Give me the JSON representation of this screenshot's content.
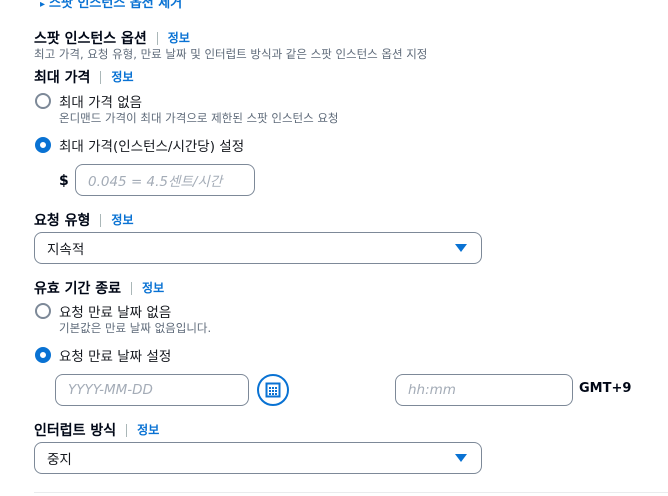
{
  "top_link": {
    "label": "스팟 인스턴스 옵션 제거"
  },
  "spot_options": {
    "title": "스팟 인스턴스 옵션",
    "info": "정보",
    "description": "최고 가격, 요청 유형, 만료 날짜 및 인터럽트 방식과 같은 스팟 인스턴스 옵션 지정"
  },
  "max_price": {
    "title": "최대 가격",
    "info": "정보",
    "option_none_label": "최대 가격 없음",
    "option_none_desc": "온디맨드 가격이 최대 가격으로 제한된 스팟 인스턴스 요청",
    "option_set_label": "최대 가격(인스턴스/시간당) 설정",
    "selected": "set",
    "currency": "$",
    "placeholder": "0.045 = 4.5센트/시간"
  },
  "request_type": {
    "title": "요청 유형",
    "info": "정보",
    "value": "지속적"
  },
  "valid_until": {
    "title": "유효 기간 종료",
    "info": "정보",
    "option_none_label": "요청 만료 날짜 없음",
    "option_none_desc": "기본값은 만료 날짜 없음입니다.",
    "option_set_label": "요청 만료 날짜 설정",
    "selected": "set",
    "date_placeholder": "YYYY-MM-DD",
    "time_placeholder": "hh:mm",
    "timezone": "GMT+9",
    "calendar_icon": "calendar-icon"
  },
  "interruption": {
    "title": "인터럽트 방식",
    "info": "정보",
    "value": "중지"
  },
  "colors": {
    "accent": "#0972d3",
    "border": "#7d8998",
    "muted": "#5f6b7a"
  }
}
